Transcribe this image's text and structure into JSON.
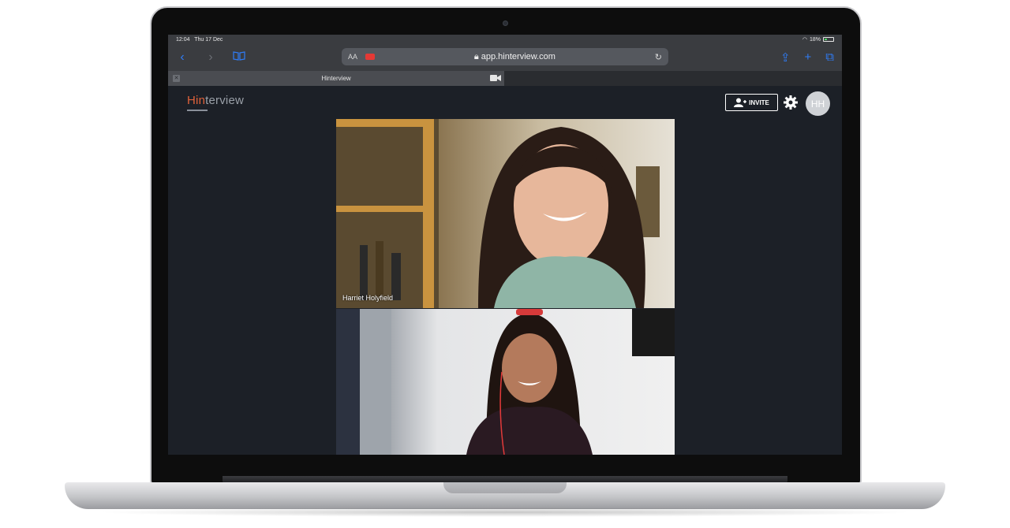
{
  "status_bar": {
    "time": "12:04",
    "date": "Thu 17 Dec",
    "battery": "18%"
  },
  "browser": {
    "text_size_label": "AA",
    "url": "app.hinterview.com",
    "tab_title": "Hinterview"
  },
  "app": {
    "logo": {
      "accent": "Hin",
      "rest": "terview"
    },
    "invite_label": "INVITE",
    "avatar_initials": "HH",
    "participants": [
      {
        "name": "Harriet Holyfield"
      },
      {
        "name": ""
      }
    ]
  },
  "colors": {
    "accent": "#2f7cf6",
    "logo": "#e0623a",
    "background": "#1c2027"
  }
}
